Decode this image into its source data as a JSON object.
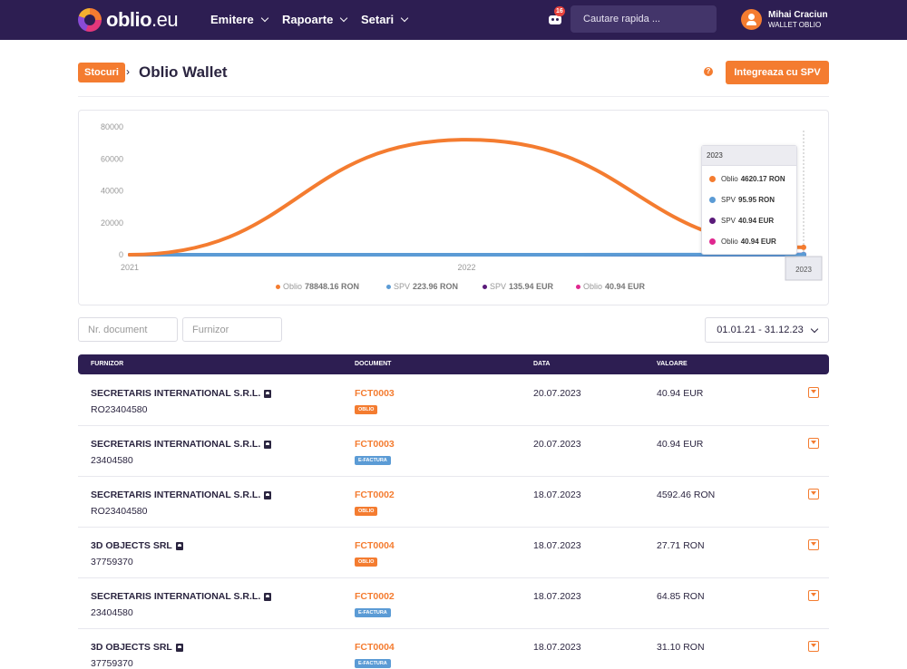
{
  "nav": {
    "logo_main": "oblio",
    "logo_tld": ".eu",
    "menus": [
      "Emitere",
      "Rapoarte",
      "Setari"
    ],
    "notifications": "16",
    "search_placeholder": "Cautare rapida ...",
    "user_name": "Mihai Craciun",
    "user_company": "WALLET OBLIO"
  },
  "header": {
    "breadcrumb": "Stocuri",
    "separator": "›",
    "title": "Oblio Wallet",
    "help": "?",
    "spv_button": "Integreaza cu SPV"
  },
  "chart_data": {
    "type": "line",
    "x": [
      "2021",
      "2022",
      "2023"
    ],
    "yticks": [
      "80000",
      "60000",
      "40000",
      "20000",
      "0"
    ],
    "ylim": [
      0,
      80000
    ],
    "series": [
      {
        "name": "Oblio",
        "currency": "RON",
        "color": "#f47c30",
        "values": [
          0,
          72000,
          4620.17
        ]
      },
      {
        "name": "SPV",
        "currency": "RON",
        "color": "#5b9bd5",
        "values": [
          0,
          0,
          95.95
        ]
      },
      {
        "name": "SPV",
        "currency": "EUR",
        "color": "#5a1a7a",
        "values": [
          0,
          0,
          40.94
        ]
      },
      {
        "name": "Oblio",
        "currency": "EUR",
        "color": "#e0278f",
        "values": [
          0,
          0,
          40.94
        ]
      }
    ],
    "legend": [
      {
        "label": "Oblio",
        "value": "78848.16 RON",
        "color": "#f47c30"
      },
      {
        "label": "SPV",
        "value": "223.96 RON",
        "color": "#5b9bd5"
      },
      {
        "label": "SPV",
        "value": "135.94 EUR",
        "color": "#5a1a7a"
      },
      {
        "label": "Oblio",
        "value": "40.94 EUR",
        "color": "#e0278f"
      }
    ],
    "tooltip": {
      "title": "2023",
      "rows": [
        {
          "label": "Oblio",
          "value": "4620.17 RON",
          "color": "#f47c30"
        },
        {
          "label": "SPV",
          "value": "95.95 RON",
          "color": "#5b9bd5"
        },
        {
          "label": "SPV",
          "value": "40.94 EUR",
          "color": "#5a1a7a"
        },
        {
          "label": "Oblio",
          "value": "40.94 EUR",
          "color": "#e0278f"
        }
      ]
    },
    "crosshair_label": "2023"
  },
  "filters": {
    "doc_placeholder": "Nr. document",
    "supplier_placeholder": "Furnizor",
    "date_range": "01.01.21 - 31.12.23"
  },
  "table": {
    "headers": [
      "FURNIZOR",
      "DOCUMENT",
      "DATA",
      "VALOARE"
    ],
    "rows": [
      {
        "name": "SECRETARIS INTERNATIONAL S.R.L.",
        "cif": "RO23404580",
        "doc": "FCT0003",
        "badge": "OBLIO",
        "date": "20.07.2023",
        "value": "40.94 EUR"
      },
      {
        "name": "SECRETARIS INTERNATIONAL S.R.L.",
        "cif": "23404580",
        "doc": "FCT0003",
        "badge": "E-FACTURA",
        "date": "20.07.2023",
        "value": "40.94 EUR"
      },
      {
        "name": "SECRETARIS INTERNATIONAL S.R.L.",
        "cif": "RO23404580",
        "doc": "FCT0002",
        "badge": "OBLIO",
        "date": "18.07.2023",
        "value": "4592.46 RON"
      },
      {
        "name": "3D OBJECTS SRL",
        "cif": "37759370",
        "doc": "FCT0004",
        "badge": "OBLIO",
        "date": "18.07.2023",
        "value": "27.71 RON"
      },
      {
        "name": "SECRETARIS INTERNATIONAL S.R.L.",
        "cif": "23404580",
        "doc": "FCT0002",
        "badge": "E-FACTURA",
        "date": "18.07.2023",
        "value": "64.85 RON"
      },
      {
        "name": "3D OBJECTS SRL",
        "cif": "37759370",
        "doc": "FCT0004",
        "badge": "E-FACTURA",
        "date": "18.07.2023",
        "value": "31.10 RON"
      }
    ]
  },
  "colors": {
    "brand": "#2d1e52",
    "accent": "#f47c30",
    "badge_oblio": "#f47c30",
    "badge_efactura": "#5b9bd5"
  }
}
